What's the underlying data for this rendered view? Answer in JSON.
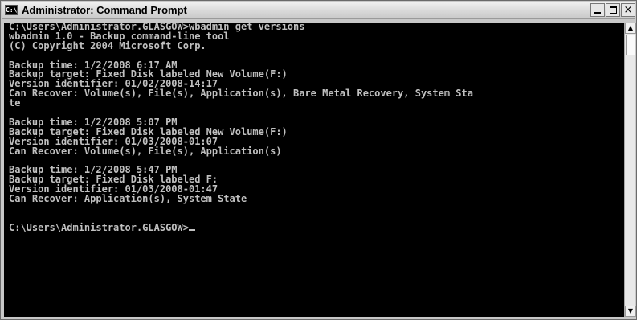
{
  "window": {
    "title": "Administrator: Command Prompt",
    "icon_label": "C:\\",
    "controls": {
      "minimize": "minimize-icon",
      "maximize": "maximize-icon",
      "close_glyph": "×"
    }
  },
  "console": {
    "lines": [
      "C:\\Users\\Administrator.GLASGOW>wbadmin get versions",
      "wbadmin 1.0 - Backup command-line tool",
      "(C) Copyright 2004 Microsoft Corp.",
      "",
      "Backup time: 1/2/2008 6:17 AM",
      "Backup target: Fixed Disk labeled New Volume(F:)",
      "Version identifier: 01/02/2008-14:17",
      "Can Recover: Volume(s), File(s), Application(s), Bare Metal Recovery, System Sta",
      "te",
      "",
      "Backup time: 1/2/2008 5:07 PM",
      "Backup target: Fixed Disk labeled New Volume(F:)",
      "Version identifier: 01/03/2008-01:07",
      "Can Recover: Volume(s), File(s), Application(s)",
      "",
      "Backup time: 1/2/2008 5:47 PM",
      "Backup target: Fixed Disk labeled F:",
      "Version identifier: 01/03/2008-01:47",
      "Can Recover: Application(s), System State",
      "",
      "",
      "C:\\Users\\Administrator.GLASGOW>"
    ]
  },
  "scrollbar": {
    "up_glyph": "▲",
    "down_glyph": "▼"
  }
}
